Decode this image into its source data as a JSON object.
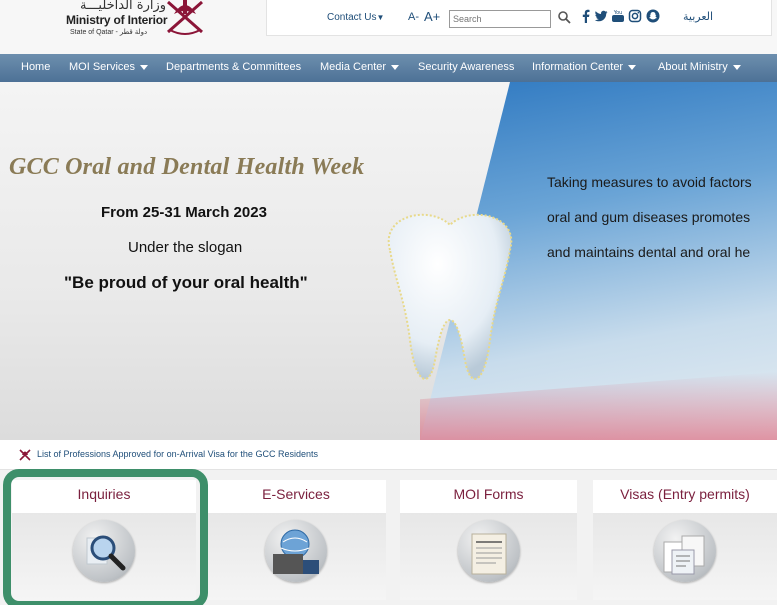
{
  "header": {
    "logo_arabic": "وزارة الداخليـــة",
    "logo_english": "Ministry of Interior",
    "logo_state": "State of Qatar - دولة قطر",
    "contact_label": "Contact Us",
    "font_decrease": "A-",
    "font_increase": "A+",
    "search_placeholder": "Search",
    "language_link": "العربية",
    "social_icons": [
      "facebook-icon",
      "twitter-icon",
      "youtube-icon",
      "instagram-icon",
      "snapchat-icon"
    ]
  },
  "nav": {
    "items": [
      {
        "label": "Home",
        "dropdown": false
      },
      {
        "label": "MOI Services",
        "dropdown": true
      },
      {
        "label": "Departments & Committees",
        "dropdown": false
      },
      {
        "label": "Media Center",
        "dropdown": true
      },
      {
        "label": "Security Awareness",
        "dropdown": false
      },
      {
        "label": "Information Center",
        "dropdown": true
      },
      {
        "label": "About Ministry",
        "dropdown": true
      }
    ]
  },
  "banner": {
    "title": "GCC Oral and Dental Health Week",
    "date": "From 25-31 March 2023",
    "slogan_intro": "Under the slogan",
    "slogan": "\"Be proud of your oral health\"",
    "right_lines": [
      "Taking measures to avoid factors",
      "oral and gum diseases promotes",
      "and maintains dental and oral he"
    ]
  },
  "notice": {
    "text": "List of Professions Approved for on-Arrival Visa for the GCC Residents"
  },
  "cards": [
    {
      "title": "Inquiries",
      "icon": "magnifier-icon"
    },
    {
      "title": "E-Services",
      "icon": "globe-laptop-icon"
    },
    {
      "title": "MOI Forms",
      "icon": "forms-icon"
    },
    {
      "title": "Visas (Entry permits)",
      "icon": "visa-documents-icon"
    }
  ],
  "colors": {
    "nav_bg": "#5a7ea3",
    "card_title": "#7a1f3d",
    "link": "#1f4e79",
    "highlight": "#3e8f6a"
  }
}
